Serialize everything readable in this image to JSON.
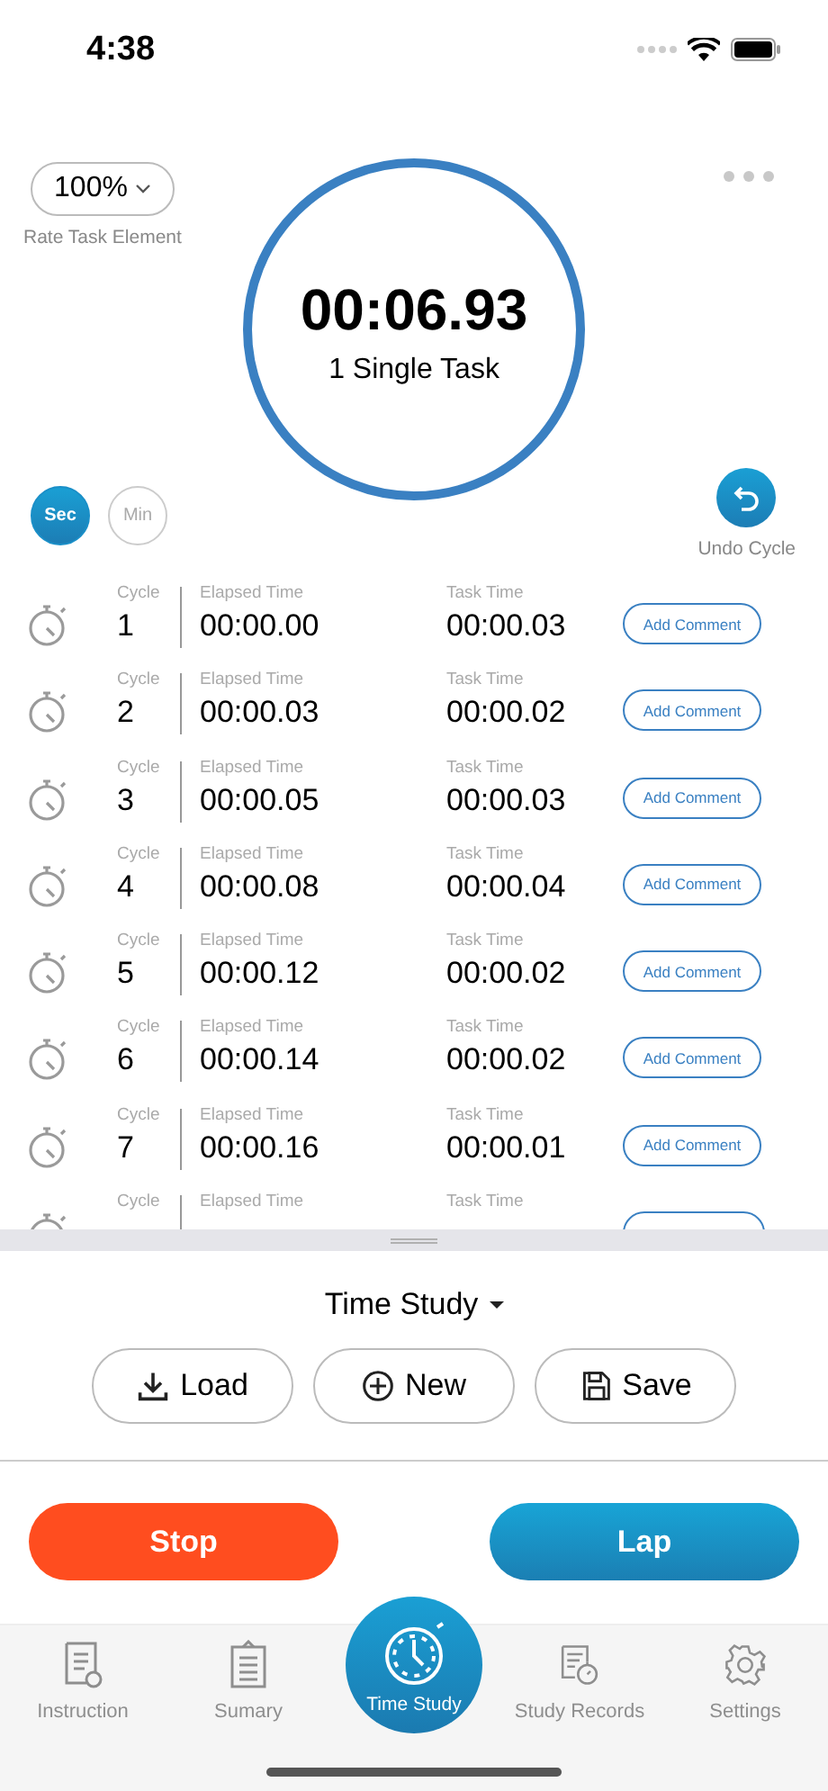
{
  "status_bar": {
    "time": "4:38"
  },
  "rate": {
    "value": "100%",
    "label": "Rate Task Element"
  },
  "timer": {
    "time": "00:06.93",
    "task": "1 Single Task"
  },
  "units": [
    {
      "label": "Sec",
      "selected": true
    },
    {
      "label": "Min",
      "selected": false
    }
  ],
  "undo": {
    "label": "Undo Cycle"
  },
  "cycles": [
    {
      "kind": "full",
      "cycle_label": "Cycle",
      "cycle": "1",
      "elapsed_label": "Elapsed Time",
      "elapsed": "00:00.00",
      "task_label": "Task Time",
      "task": "00:00.03",
      "button": "Add Comment"
    },
    {
      "kind": "full",
      "cycle_label": "Cycle",
      "cycle": "2",
      "elapsed_label": "Elapsed Time",
      "elapsed": "00:00.03",
      "task_label": "Task Time",
      "task": "00:00.02",
      "button": "Add Comment"
    },
    {
      "kind": "full",
      "cycle_label": "Cycle",
      "cycle": "3",
      "elapsed_label": "Elapsed Time",
      "elapsed": "00:00.05",
      "task_label": "Task Time",
      "task": "00:00.03",
      "button": "Add Comment"
    },
    {
      "kind": "full",
      "cycle_label": "Cycle",
      "cycle": "4",
      "elapsed_label": "Elapsed Time",
      "elapsed": "00:00.08",
      "task_label": "Task Time",
      "task": "00:00.04",
      "button": "Add Comment"
    },
    {
      "kind": "full",
      "cycle_label": "Cycle",
      "cycle": "5",
      "elapsed_label": "Elapsed Time",
      "elapsed": "00:00.12",
      "task_label": "Task Time",
      "task": "00:00.02",
      "button": "Add Comment"
    },
    {
      "kind": "full",
      "cycle_label": "Cycle",
      "cycle": "6",
      "elapsed_label": "Elapsed Time",
      "elapsed": "00:00.14",
      "task_label": "Task Time",
      "task": "00:00.02",
      "button": "Add Comment"
    },
    {
      "kind": "full",
      "cycle_label": "Cycle",
      "cycle": "7",
      "elapsed_label": "Elapsed Time",
      "elapsed": "00:00.16",
      "task_label": "Task Time",
      "task": "00:00.01",
      "button": "Add Comment"
    },
    {
      "kind": "partial",
      "cycle_label": "Cycle",
      "elapsed_label": "Elapsed Time",
      "task_label": "Task Time"
    }
  ],
  "study": {
    "title": "Time Study",
    "actions": [
      {
        "kind": "load",
        "label": "Load"
      },
      {
        "kind": "new",
        "label": "New"
      },
      {
        "kind": "save",
        "label": "Save"
      }
    ]
  },
  "controls": {
    "stop": "Stop",
    "lap": "Lap"
  },
  "tabs": [
    {
      "kind": "instruction",
      "label": "Instruction",
      "selected": false
    },
    {
      "kind": "summary",
      "label": "Sumary",
      "selected": false
    },
    {
      "kind": "timer",
      "label": "Time Study",
      "selected": true
    },
    {
      "kind": "records",
      "label": "Study Records",
      "selected": false
    },
    {
      "kind": "settings",
      "label": "Settings",
      "selected": false
    }
  ]
}
